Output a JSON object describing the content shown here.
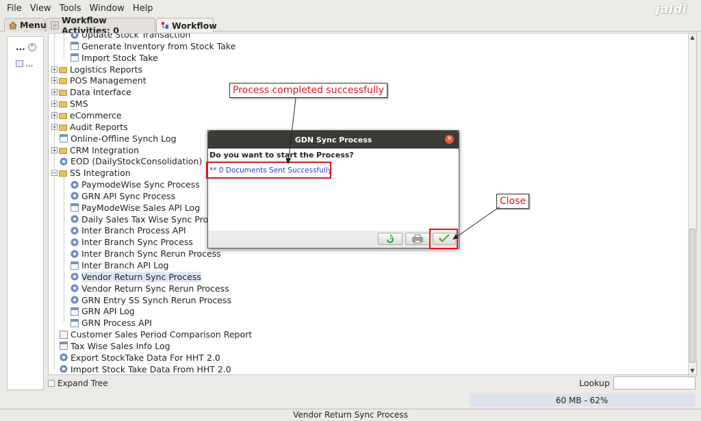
{
  "menubar": {
    "items": [
      "File",
      "View",
      "Tools",
      "Window",
      "Help"
    ],
    "logo": "jaldi"
  },
  "tabs": {
    "menu": "Menu",
    "workflow_activities": "Workflow Activities: 0",
    "workflow": "Workflow"
  },
  "leftpanel": {
    "row1": "...",
    "row2": "..."
  },
  "tree": {
    "items": [
      "Update Stock Transaction",
      "Generate Inventory from Stock Take",
      "Import Stock Take",
      "Logistics Reports",
      "POS Management",
      "Data Interface",
      "SMS",
      "eCommerce",
      "Audit Reports",
      "Online-Offline Synch Log",
      "CRM Integration",
      "EOD (DailyStockConsolidation)",
      "SS Integration",
      "PaymodeWise Sync Process",
      "GRN API Sync Process",
      "PayModeWise Sales API Log",
      "Daily Sales Tax Wise Sync Process",
      "Inter Branch Process API",
      "Inter Branch Sync Process",
      "Inter Branch Sync Rerun Process",
      "Inter Branch API Log",
      "Vendor Return Sync Process",
      "Vendor Return Sync Rerun Process",
      "GRN Entry SS Synch Rerun Process",
      "GRN API Log",
      "GRN Process API",
      "Customer Sales Period Comparison Report",
      "Tax Wise Sales Info Log",
      "Export StockTake Data For HHT 2.0",
      "Import Stock Take Data From HHT 2.0"
    ]
  },
  "bottombar": {
    "expand_tree": "Expand Tree",
    "lookup": "Lookup"
  },
  "memory": "60 MB - 62%",
  "statusbar": "Vendor Return Sync Process",
  "dialog": {
    "title": "GDN Sync Process",
    "question": "Do you want to start the Process?",
    "message": "** 0 Documents Sent Successfully"
  },
  "annotations": {
    "callout1": "Process completed successfully",
    "callout2": "Close"
  }
}
